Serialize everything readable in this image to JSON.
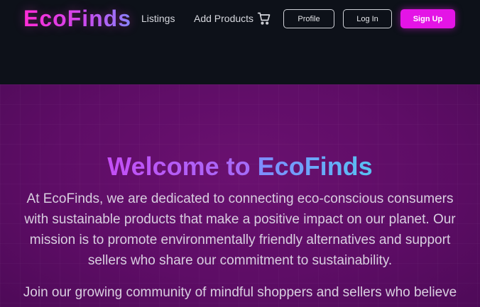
{
  "header": {
    "logo": "EcoFinds",
    "nav": {
      "listings": "Listings",
      "add_products": "Add Products"
    },
    "cart_icon": "shopping-cart-icon",
    "buttons": {
      "profile": "Profile",
      "login": "Log In",
      "signup": "Sign Up"
    }
  },
  "hero": {
    "title_part1": "Welcome to",
    "title_part2": "EcoFinds",
    "paragraph1": "At EcoFinds, we are dedicated to connecting eco-conscious consumers with sustainable products that make a positive impact on our planet. Our mission is to promote environmentally friendly alternatives and support sellers who share our commitment to sustainability.",
    "paragraph2": "Join our growing community of mindful shoppers and sellers who believe"
  },
  "colors": {
    "background": "#0d1119",
    "hero_background": "#5e0d66",
    "accent_pink": "#e414e6",
    "text_light": "#d9cfe0"
  }
}
